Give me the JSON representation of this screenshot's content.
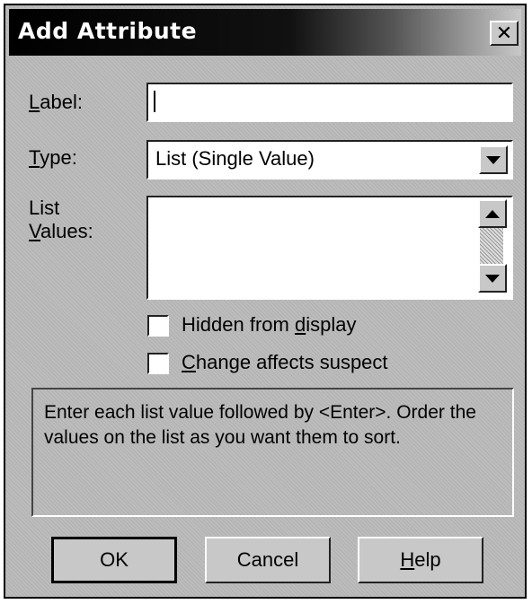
{
  "window": {
    "title": "Add Attribute",
    "close_glyph": "✕"
  },
  "form": {
    "label": {
      "mnemonic": "L",
      "rest": "abel:",
      "value": ""
    },
    "type": {
      "mnemonic": "T",
      "rest": "ype:",
      "value": "List (Single Value)"
    },
    "list_values": {
      "line1": "List",
      "mnemonic": "V",
      "rest": "alues:",
      "items": []
    },
    "hidden": {
      "prefix": "Hidden from ",
      "mnemonic": "d",
      "rest": "isplay",
      "checked": false
    },
    "suspect": {
      "mnemonic": "C",
      "rest": "hange affects suspect",
      "checked": false
    }
  },
  "info": {
    "text": "Enter each list value followed by <Enter>. Order the values on the list as you want them to sort."
  },
  "buttons": {
    "ok": "OK",
    "cancel": "Cancel",
    "help_mnemonic": "H",
    "help_rest": "elp"
  },
  "icons": {
    "close": "close-icon",
    "dropdown": "chevron-down-icon",
    "scroll_up": "arrow-up-icon",
    "scroll_down": "arrow-down-icon"
  }
}
